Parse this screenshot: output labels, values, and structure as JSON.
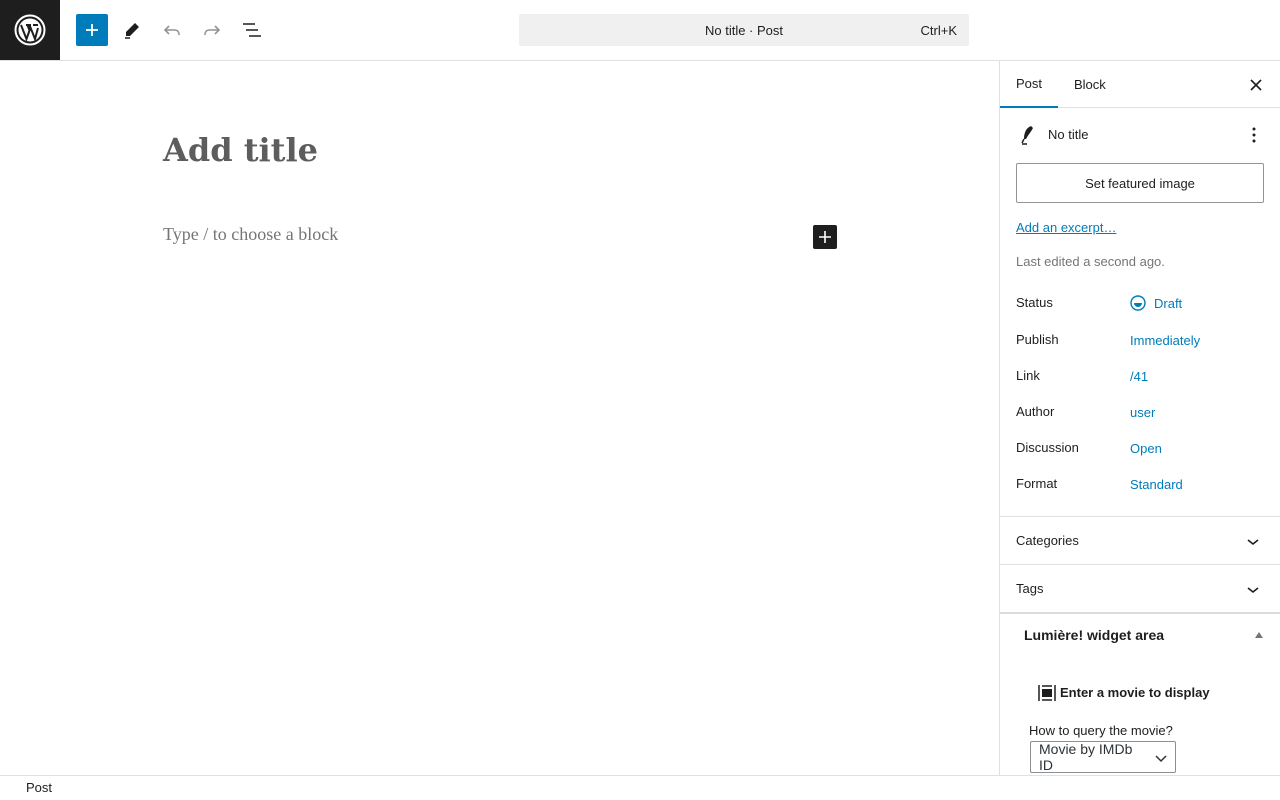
{
  "toolbar": {
    "command_title": "No title · Post",
    "command_shortcut": "Ctrl+K"
  },
  "editor": {
    "title_placeholder": "Add title",
    "block_placeholder": "Type / to choose a block"
  },
  "sidebar": {
    "tabs": [
      {
        "label": "Post"
      },
      {
        "label": "Block"
      }
    ],
    "post_title": "No title",
    "featured_image_label": "Set featured image",
    "excerpt_link": "Add an excerpt…",
    "last_edited": "Last edited a second ago.",
    "rows": [
      {
        "label": "Status",
        "value": "Draft"
      },
      {
        "label": "Publish",
        "value": "Immediately"
      },
      {
        "label": "Link",
        "value": "/41"
      },
      {
        "label": "Author",
        "value": "user"
      },
      {
        "label": "Discussion",
        "value": "Open"
      },
      {
        "label": "Format",
        "value": "Standard"
      }
    ],
    "panels": [
      {
        "label": "Categories"
      },
      {
        "label": "Tags"
      }
    ],
    "widget": {
      "title": "Lumière! widget area",
      "movie_prompt": "Enter a movie to display",
      "query_label": "How to query the movie?",
      "query_selected": "Movie by IMDb ID"
    }
  },
  "footer": {
    "breadcrumb": "Post"
  },
  "colors": {
    "accent": "#007cba",
    "dark": "#1e1e1e",
    "muted": "#757575"
  }
}
